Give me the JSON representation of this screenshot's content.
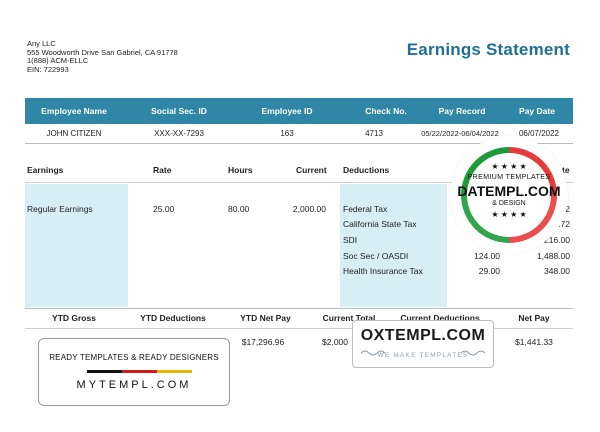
{
  "company": {
    "name": "Any LLC",
    "address": "555 Woodworth Drive San Gabriel, CA 91778",
    "phone": "1(888) ACM-ELLC",
    "ein": "EIN: 722993"
  },
  "title": "Earnings Statement",
  "employee_table": {
    "headers": [
      "Employee Name",
      "Social Sec. ID",
      "Employee ID",
      "Check No.",
      "Pay Record",
      "Pay Date"
    ],
    "row": [
      "JOHN CITIZEN",
      "XXX-XX-7293",
      "163",
      "4713",
      "05/22/2022-06/04/2022",
      "06/07/2022"
    ]
  },
  "earnings": {
    "headers": {
      "earnings": "Earnings",
      "rate": "Rate",
      "hours": "Hours",
      "current": "Current",
      "deductions": "Deductions",
      "ytd": "YTD",
      "last": "te"
    },
    "row": {
      "label": "Regular Earnings",
      "rate": "25.00",
      "hours": "80.00",
      "current": "2,000.00"
    },
    "deductions": [
      {
        "label": "Federal Tax",
        "current": "",
        "ytd": "32"
      },
      {
        "label": "California State Tax",
        "current": "",
        "ytd": "58.72"
      },
      {
        "label": "SDI",
        "current": "18.00",
        "ytd": "216.00"
      },
      {
        "label": "Soc Sec / OASDI",
        "current": "124.00",
        "ytd": "1,488.00"
      },
      {
        "label": "Health Insurance Tax",
        "current": "29.00",
        "ytd": "348.00"
      }
    ]
  },
  "ytd": {
    "headers": [
      "YTD Gross",
      "YTD Deductions",
      "YTD Net Pay",
      "Current Total",
      "Current Deductions",
      "Net Pay"
    ],
    "values": [
      "",
      "",
      "$17,296.96",
      "$2,000",
      "",
      "$1,441.33"
    ]
  },
  "badge": {
    "stars_top": "★ ★ ★ ★",
    "line1": "PREMIUM TEMPLATES",
    "line2": "DATEMPL.COM",
    "line3": "& DESIGN",
    "stars_bottom": "★ ★ ★ ★"
  },
  "banner": {
    "top": "READY TEMPLATES & READY DESIGNERS",
    "bottom": "MYTEMPL.COM",
    "colors": [
      "#111111",
      "#d11a1a",
      "#e7b400"
    ]
  },
  "ox": {
    "big": "OXTEMPL.COM",
    "small": "WE MAKE TEMPLATES"
  },
  "colors": {
    "accent": "#2f86a6",
    "title": "#1f6f96",
    "light_col": "#d8eef6"
  }
}
